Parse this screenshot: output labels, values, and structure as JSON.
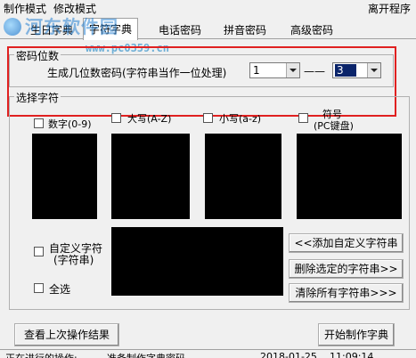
{
  "menu": {
    "make_mode": "制作模式",
    "edit_mode": "修改模式",
    "exit": "离开程序"
  },
  "watermark": {
    "title": "河东软件园",
    "url": "www.pc0359.cn"
  },
  "tabs": [
    {
      "label": "生日字典"
    },
    {
      "label": "字符字典"
    },
    {
      "label": "电话密码"
    },
    {
      "label": "拼音密码"
    },
    {
      "label": "高级密码"
    }
  ],
  "digits_group": {
    "title": "密码位数",
    "generate_label": "生成几位数密码(字符串当作一位处理)",
    "min_value": "1",
    "separator": "——",
    "max_value": "3"
  },
  "charset_group": {
    "title": "选择字符",
    "options": [
      {
        "label": "数字(0-9)"
      },
      {
        "label": "大写(A-Z)"
      },
      {
        "label": "小写(a-z)"
      },
      {
        "label_line1": "符号",
        "label_line2": "(PC键盘)"
      }
    ],
    "custom_label_line1": "自定义字符",
    "custom_label_line2": "(字符串)",
    "select_all": "全选",
    "add_custom_button": "<<添加自定义字符串",
    "delete_selected_button": "删除选定的字符串>>",
    "clear_all_button": "清除所有字符串>>>"
  },
  "bottom": {
    "view_last_button": "查看上次操作结果",
    "start_button": "开始制作字典"
  },
  "status": {
    "operation_label": "正在进行的操作:",
    "operation_value": "准备制作字典密码",
    "date": "2018-01-25",
    "time": "11:09:14"
  },
  "colors": {
    "highlight": "#e02020",
    "panel": "#000000"
  }
}
